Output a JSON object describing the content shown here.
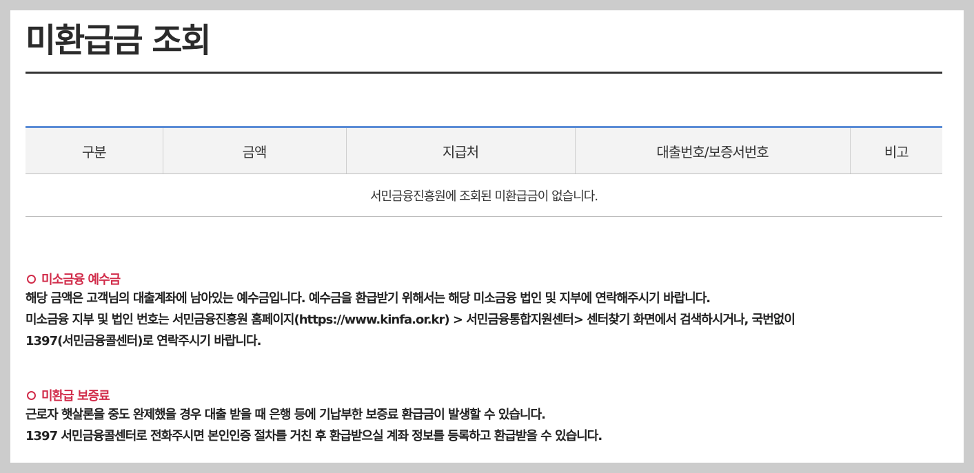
{
  "page": {
    "title": "미환급금 조회"
  },
  "table": {
    "headers": [
      "구분",
      "금액",
      "지급처",
      "대출번호/보증서번호",
      "비고"
    ],
    "empty_message": "서민금융진흥원에 조회된 미환급금이 없습니다."
  },
  "sections": [
    {
      "heading": "미소금융 예수금",
      "lines": [
        "해당 금액은 고객님의 대출계좌에 남아있는 예수금입니다. 예수금을 환급받기 위해서는 해당 미소금융 법인 및 지부에 연락해주시기 바랍니다.",
        "미소금융 지부 및 법인 번호는 서민금융진흥원 홈페이지(https://www.kinfa.or.kr) > 서민금융통합지원센터> 센터찾기 화면에서 검색하시거나, 국번없이",
        "1397(서민금융콜센터)로 연락주시기 바랍니다."
      ]
    },
    {
      "heading": "미환급 보증료",
      "lines": [
        "근로자 햇살론을 중도 완제했을 경우 대출 받을 때 은행 등에 기납부한 보증료 환급금이 발생할 수 있습니다.",
        "1397 서민금융콜센터로 전화주시면 본인인증 절차를 거친 후 환급받으실 계좌 정보를 등록하고 환급받을 수 있습니다."
      ]
    }
  ],
  "colors": {
    "accent": "#5b8dd6",
    "highlight": "#d12c4a",
    "header_bg": "#f3f3f3"
  }
}
